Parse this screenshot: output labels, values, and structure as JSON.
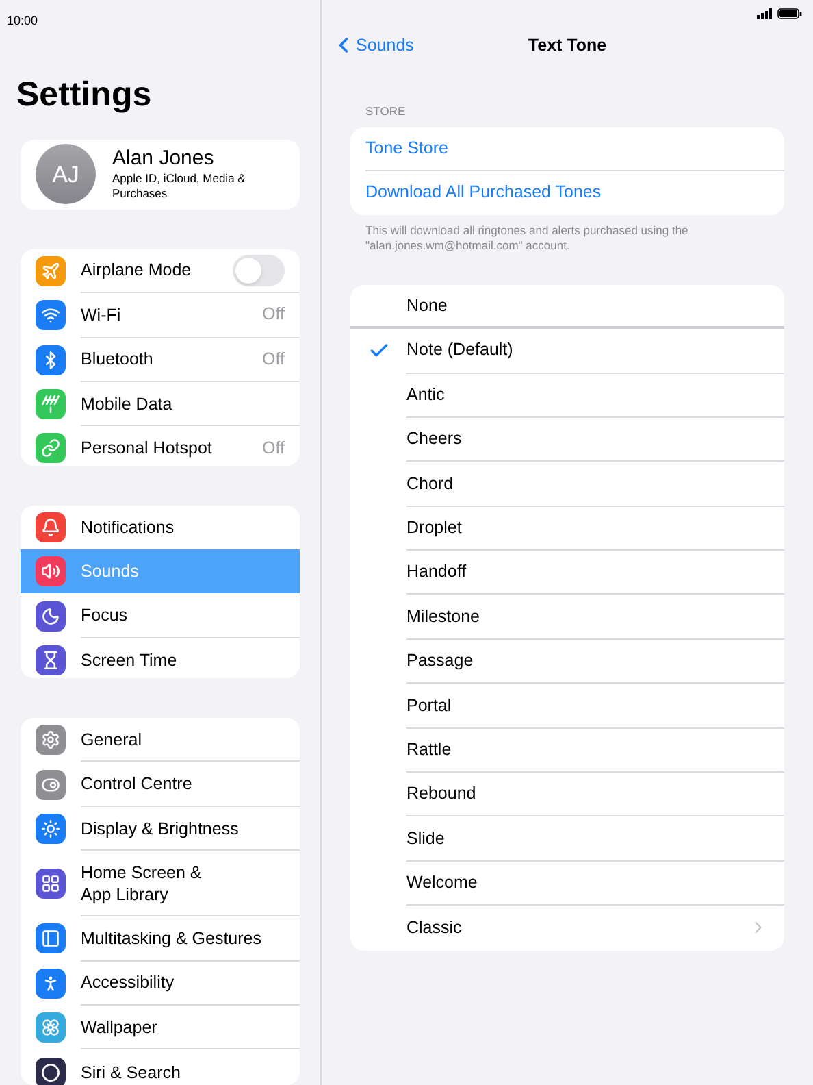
{
  "status_bar": {
    "time": "10:00"
  },
  "sidebar": {
    "title": "Settings",
    "profile": {
      "initials": "AJ",
      "name": "Alan Jones",
      "subtitle": "Apple ID, iCloud, Media & Purchases"
    },
    "groups": [
      {
        "items": [
          {
            "kind": "toggle",
            "label": "Airplane Mode",
            "on": false,
            "selected": false
          },
          {
            "kind": "value",
            "label": "Wi-Fi",
            "value": "Off",
            "selected": false
          },
          {
            "kind": "value",
            "label": "Bluetooth",
            "value": "Off",
            "selected": false
          },
          {
            "kind": "plain",
            "label": "Mobile Data",
            "selected": false
          },
          {
            "kind": "value",
            "label": "Personal Hotspot",
            "value": "Off",
            "selected": false
          }
        ]
      },
      {
        "items": [
          {
            "kind": "plain",
            "label": "Notifications",
            "selected": false
          },
          {
            "kind": "plain",
            "label": "Sounds",
            "selected": true
          },
          {
            "kind": "plain",
            "label": "Focus",
            "selected": false
          },
          {
            "kind": "plain",
            "label": "Screen Time",
            "selected": false
          }
        ]
      },
      {
        "items": [
          {
            "kind": "plain",
            "label": "General",
            "selected": false
          },
          {
            "kind": "plain",
            "label": "Control Centre",
            "selected": false
          },
          {
            "kind": "plain",
            "label": "Display & Brightness",
            "selected": false
          },
          {
            "kind": "tall",
            "label": "Home Screen & App Library",
            "selected": false
          },
          {
            "kind": "plain",
            "label": "Multitasking & Gestures",
            "selected": false
          },
          {
            "kind": "plain",
            "label": "Accessibility",
            "selected": false
          },
          {
            "kind": "plain",
            "label": "Wallpaper",
            "selected": false
          },
          {
            "kind": "plain",
            "label": "Siri & Search",
            "selected": false
          }
        ]
      }
    ]
  },
  "detail": {
    "back": "Sounds",
    "title": "Text Tone",
    "store": {
      "header": "STORE",
      "links": [
        "Tone Store",
        "Download All Purchased Tones"
      ],
      "footer": "This will download all ringtones and alerts purchased using the \"alan.jones.wm@hotmail.com\" account."
    },
    "tones": [
      {
        "kind": "plain",
        "label": "None",
        "selected": false
      },
      {
        "kind": "plain",
        "label": "Note (Default)",
        "selected": true
      },
      {
        "kind": "plain",
        "label": "Antic",
        "selected": false
      },
      {
        "kind": "plain",
        "label": "Cheers",
        "selected": false
      },
      {
        "kind": "plain",
        "label": "Chord",
        "selected": false
      },
      {
        "kind": "plain",
        "label": "Droplet",
        "selected": false
      },
      {
        "kind": "plain",
        "label": "Handoff",
        "selected": false
      },
      {
        "kind": "plain",
        "label": "Milestone",
        "selected": false
      },
      {
        "kind": "plain",
        "label": "Passage",
        "selected": false
      },
      {
        "kind": "plain",
        "label": "Portal",
        "selected": false
      },
      {
        "kind": "plain",
        "label": "Rattle",
        "selected": false
      },
      {
        "kind": "plain",
        "label": "Rebound",
        "selected": false
      },
      {
        "kind": "plain",
        "label": "Slide",
        "selected": false
      },
      {
        "kind": "plain",
        "label": "Welcome",
        "selected": false
      },
      {
        "kind": "link",
        "label": "Classic",
        "selected": false
      }
    ]
  }
}
